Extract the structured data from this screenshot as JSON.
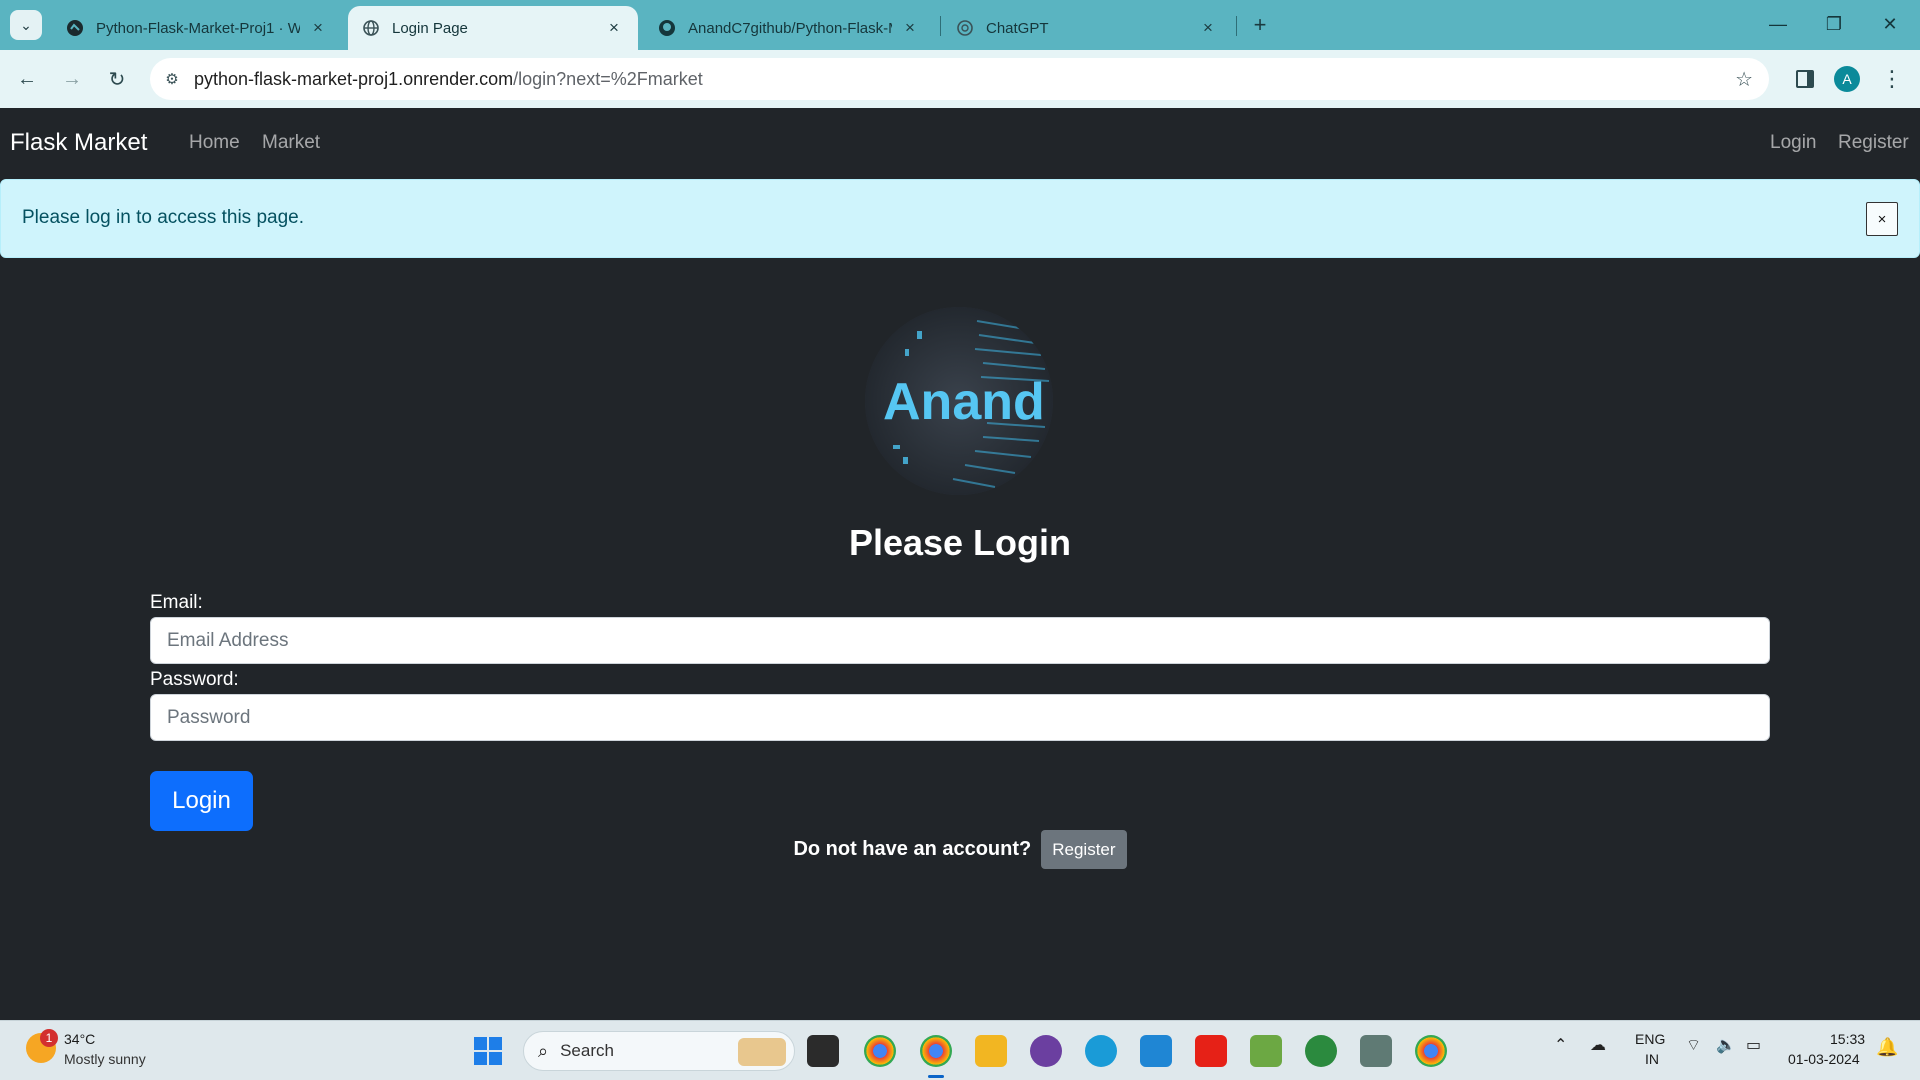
{
  "browser": {
    "tabs": [
      {
        "title": "Python-Flask-Market-Proj1 · W",
        "icon": "flask-render-icon"
      },
      {
        "title": "Login Page",
        "icon": "globe-icon"
      },
      {
        "title": "AnandC7github/Python-Flask-M",
        "icon": "github-icon"
      },
      {
        "title": "ChatGPT",
        "icon": "openai-icon"
      }
    ],
    "url_host": "python-flask-market-proj1.onrender.com",
    "url_path": "/login?next=%2Fmarket",
    "profile_initial": "A"
  },
  "navbar": {
    "brand": "Flask Market",
    "links": [
      "Home",
      "Market"
    ],
    "right_links": [
      "Login",
      "Register"
    ]
  },
  "alert": {
    "message": "Please log in to access this page.",
    "close": "×"
  },
  "logo_text": "Anand",
  "form": {
    "heading": "Please Login",
    "email_label": "Email:",
    "email_placeholder": "Email Address",
    "password_label": "Password:",
    "password_placeholder": "Password",
    "submit": "Login",
    "no_account": "Do not have an account?",
    "register": "Register"
  },
  "taskbar": {
    "weather_temp": "34°C",
    "weather_desc": "Mostly sunny",
    "weather_badge": "1",
    "search": "Search",
    "lang_line1": "ENG",
    "lang_line2": "IN",
    "time": "15:33",
    "date": "01-03-2024"
  },
  "colors": {
    "accent": "#0d6efd",
    "navbar_bg": "#212529",
    "alert_bg": "#cff4fc",
    "tabbar_bg": "#5ab4c1"
  }
}
